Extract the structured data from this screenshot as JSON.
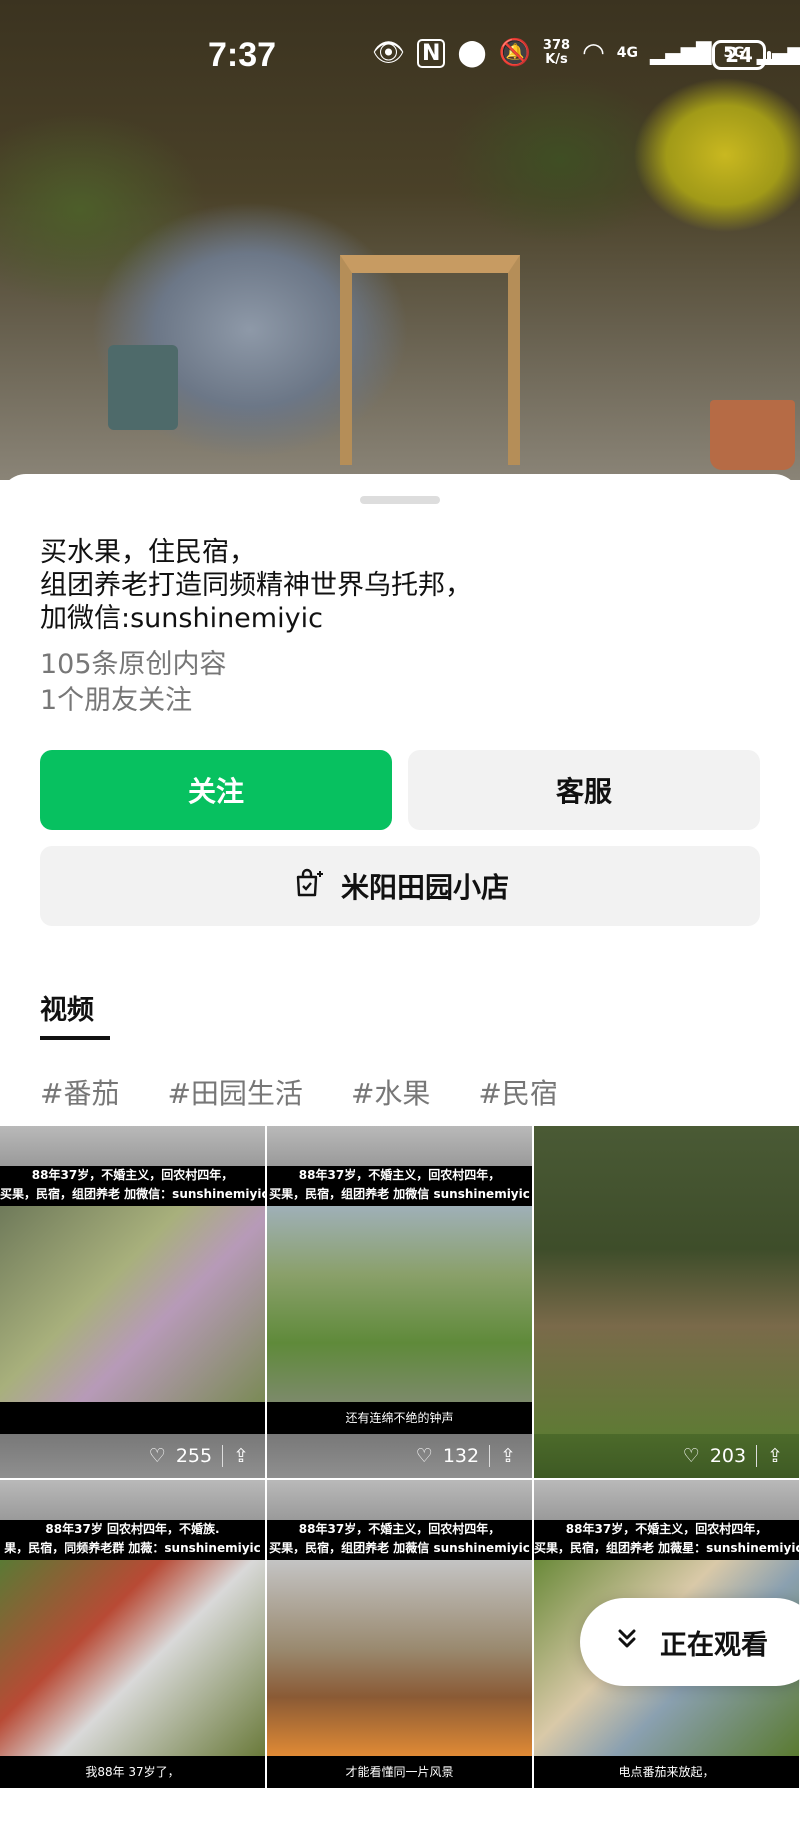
{
  "status_bar": {
    "time": "7:37",
    "network_speed": "378\nK/s",
    "signal_4g": "4G",
    "signal_5g": "5G",
    "battery": "24"
  },
  "profile": {
    "bio": "买水果，住民宿，\n组团养老打造同频精神世界乌托邦，\n 加微信:sunshinemiyic",
    "original_content": "105条原创内容",
    "friends_following": "1个朋友关注"
  },
  "actions": {
    "follow_label": "关注",
    "service_label": "客服",
    "shop_label": "米阳田园小店"
  },
  "tabs": {
    "active": "视频"
  },
  "tags": [
    "#番茄",
    "#田园生活",
    "#水果",
    "#民宿"
  ],
  "videos": [
    {
      "caption": "88年37岁，不婚主义，回农村四年，\n买果，民宿，组团养老 加微信：sunshinemiyic",
      "subtitle": "",
      "likes": "255"
    },
    {
      "caption": "88年37岁，不婚主义，回农村四年，\n买果，民宿，组团养老 加微信 sunshinemiyic",
      "subtitle": "还有连绵不绝的钟声",
      "likes": "132"
    },
    {
      "caption": "",
      "subtitle": "",
      "likes": "203"
    },
    {
      "caption": "88年37岁 回农村四年，不婚族.\n果，民宿，同频养老群 加薇：sunshinemiyic",
      "subtitle": "我88年  37岁了，",
      "likes": ""
    },
    {
      "caption": "88年37岁，不婚主义，回农村四年，\n买果，民宿，组团养老 加薇信 sunshinemiyic",
      "subtitle": "才能看懂同一片风景",
      "likes": ""
    },
    {
      "caption": "88年37岁，不婚主义，回农村四年，\n买果，民宿，组团养老 加薇星：sunshinemiyic",
      "subtitle": "电点番茄来放起，",
      "likes": ""
    }
  ],
  "watching_label": "正在观看",
  "colors": {
    "follow_green": "#07c160",
    "secondary_button": "#f2f2f2",
    "muted_text": "#777777"
  },
  "icons": [
    "eye-icon",
    "nfc-icon",
    "location-icon",
    "mute-icon",
    "wifi-icon",
    "heart-icon",
    "share-icon",
    "shop-bag-icon",
    "double-chevron-down-icon"
  ]
}
